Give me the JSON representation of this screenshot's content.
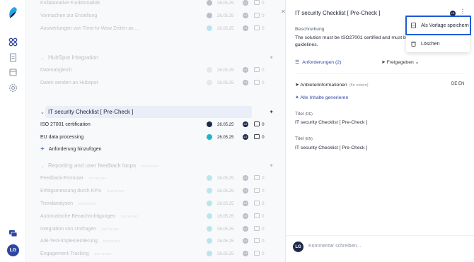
{
  "colors": {
    "accent": "#2f45a3",
    "done": "#1f2a4a",
    "progress": "#20b5c8",
    "empty": "#b6bcc8",
    "focus": "#1f5bd6"
  },
  "sidebar": {
    "icons": [
      "app-logo",
      "dashboard-icon",
      "document-icon",
      "checklist-icon",
      "settings-icon"
    ],
    "bottom": [
      "chat-icon"
    ],
    "user_initials": "LG"
  },
  "main": {
    "top_rows": [
      {
        "label": "Kollaborative Funktionalität",
        "date": "26.05.25",
        "avatar": "LG",
        "comments": "0"
      },
      {
        "label": "Vormachen zur Erstellung",
        "date": "26.05.25",
        "avatar": "LG",
        "comments": "0"
      },
      {
        "label": "Auswertungen von Time-to-Wow Zeiten as ...",
        "date": "26.05.25",
        "avatar": "LG",
        "comments": "0"
      }
    ],
    "hubspot": {
      "title": "HubSpot Integration",
      "rows": [
        {
          "label": "Datenabgleich",
          "date": "26.05.25",
          "avatar": "LG",
          "comments": "0"
        },
        {
          "label": "Daten senden an Hubspot",
          "date": "26.05.25",
          "avatar": "LG",
          "comments": "0"
        }
      ]
    },
    "security": {
      "title": "IT security Checklist [ Pre-Check ]",
      "rows": [
        {
          "label": "ISO 27001 certification",
          "date": "26.05.25",
          "avatar": "LG",
          "comments": "0"
        },
        {
          "label": "EU data processing",
          "date": "26.05.25",
          "avatar": "LG",
          "comments": "0"
        }
      ],
      "add_label": "Anforderung hinzufügen"
    },
    "reporting": {
      "title": "Reporting and user feedback loops",
      "badge": "ENTWURF",
      "rows": [
        {
          "label": "Feedback-Formular",
          "badge": "ENTWURF",
          "date": "26.05.25",
          "avatar": "LG",
          "comments": "0"
        },
        {
          "label": "Erfolgsmessung durch KPIs",
          "badge": "ENTWURF",
          "date": "26.05.25",
          "avatar": "LG",
          "comments": "0"
        },
        {
          "label": "Trendanalysen",
          "badge": "ENTWURF",
          "date": "26.05.25",
          "avatar": "LG",
          "comments": "0"
        },
        {
          "label": "Automatische Benachrichtigungen",
          "badge": "ENTWURF",
          "date": "26.05.25",
          "avatar": "LG",
          "comments": "0"
        },
        {
          "label": "Integration von Umfragen",
          "badge": "ENTWURF",
          "date": "26.05.25",
          "avatar": "LG",
          "comments": "0"
        },
        {
          "label": "A/B-Test-Implementierung",
          "badge": "ENTWURF",
          "date": "26.05.25",
          "avatar": "LG",
          "comments": "0"
        },
        {
          "label": "Engagement-Tracking",
          "badge": "ENTWURF",
          "date": "26.05.25",
          "avatar": "LG",
          "comments": "0"
        }
      ]
    }
  },
  "panel": {
    "title": "IT security Checklist [ Pre-Check ]",
    "header_avatar": "LG",
    "desc_label": "Beschreibung",
    "desc_text": "The solution must be ISO27001 certified and must be European GDPR guidelines.",
    "tab_requirements": "Anforderungen (2)",
    "share_label": "Freigegeben",
    "provider_info": "Anbieterinformationen",
    "provider_ext": "(für extern)",
    "lang": "DE  EN",
    "generate_all": "Alle Inhalte generieren",
    "field1_label": "Titel",
    "field1_lang": "(DE)",
    "field1_value": "IT security Checklist [ Pre-Check ]",
    "field2_label": "Titel",
    "field2_lang": "(EN)",
    "field2_value": "IT security Checklist [ Pre-Check ]",
    "comment_avatar": "LG",
    "comment_placeholder": "Kommentar schreiben..."
  },
  "menu": {
    "save_template": "Als Vorlage speichern",
    "delete": "Löschen"
  }
}
